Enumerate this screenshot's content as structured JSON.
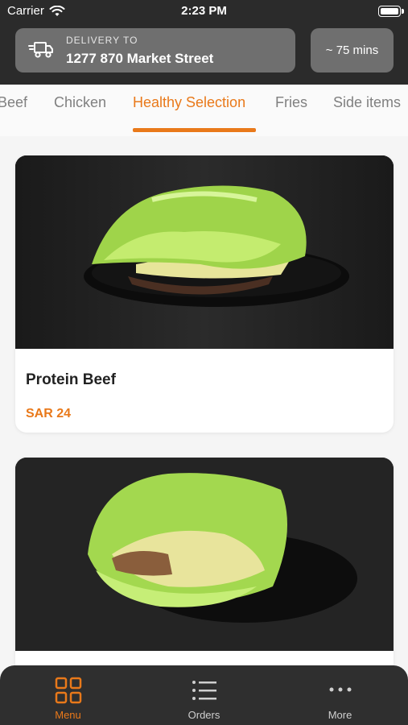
{
  "status": {
    "carrier": "Carrier",
    "time": "2:23 PM"
  },
  "header": {
    "delivery_label": "DELIVERY TO",
    "delivery_address": "1277 870 Market Street",
    "eta": "~ 75 mins"
  },
  "tabs": [
    {
      "label": "Beef",
      "active": false
    },
    {
      "label": "Chicken",
      "active": false
    },
    {
      "label": "Healthy Selection",
      "active": true
    },
    {
      "label": "Fries",
      "active": false
    },
    {
      "label": "Side items",
      "active": false
    }
  ],
  "products": [
    {
      "name": "Protein Beef",
      "price": "SAR 24"
    },
    {
      "name": "",
      "price": ""
    }
  ],
  "bottom_nav": [
    {
      "label": "Menu",
      "icon": "grid-icon",
      "active": true
    },
    {
      "label": "Orders",
      "icon": "list-icon",
      "active": false
    },
    {
      "label": "More",
      "icon": "more-icon",
      "active": false
    }
  ],
  "colors": {
    "accent": "#e9791a",
    "header_bg": "#2b2b2b",
    "pill_bg": "#6f6f6f"
  }
}
